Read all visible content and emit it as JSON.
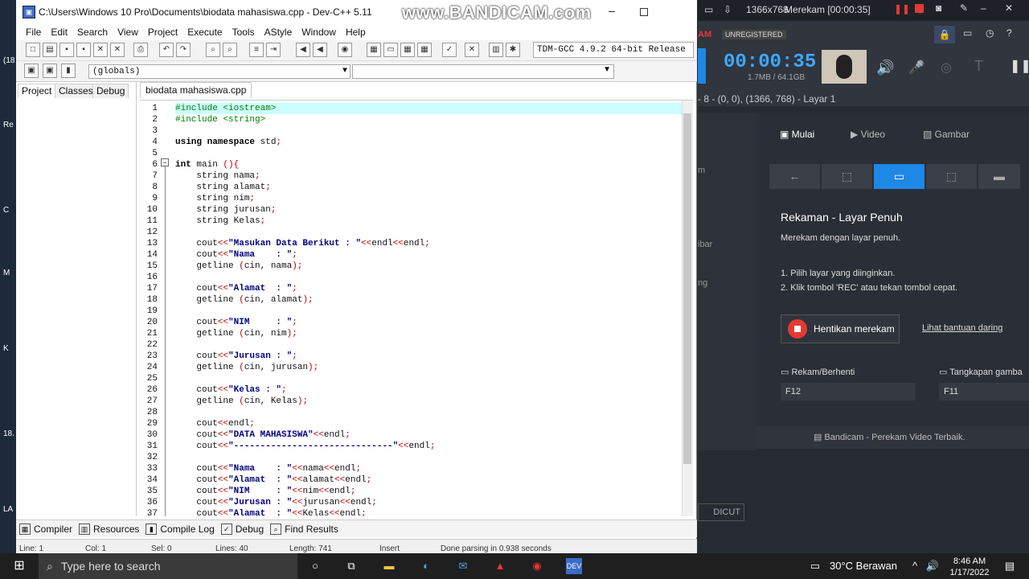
{
  "devcpp": {
    "title": "C:\\Users\\Windows 10 Pro\\Documents\\biodata mahasiswa.cpp - Dev-C++ 5.11",
    "menu": [
      "File",
      "Edit",
      "Search",
      "View",
      "Project",
      "Execute",
      "Tools",
      "AStyle",
      "Window",
      "Help"
    ],
    "compiler": "TDM-GCC 4.9.2 64-bit Release",
    "scope": "(globals)",
    "panel_tabs": [
      "Project",
      "Classes",
      "Debug"
    ],
    "file_tab": "biodata mahasiswa.cpp",
    "bottom_tabs": [
      "Compiler",
      "Resources",
      "Compile Log",
      "Debug",
      "Find Results"
    ],
    "status": [
      "Line: 1",
      "Col: 1",
      "Sel: 0",
      "Lines: 40",
      "Length: 741",
      "Insert",
      "Done parsing in 0.938 seconds"
    ],
    "code_lines": [
      {
        "n": "1",
        "t": [
          {
            "c": "pp",
            "s": "#include <iostream>"
          }
        ]
      },
      {
        "n": "2",
        "t": [
          {
            "c": "pp",
            "s": "#include <string>"
          }
        ]
      },
      {
        "n": "3",
        "t": []
      },
      {
        "n": "4",
        "t": [
          {
            "c": "kw",
            "s": "using namespace"
          },
          {
            "c": "",
            "s": " std"
          },
          {
            "c": "sym",
            "s": ";"
          }
        ]
      },
      {
        "n": "5",
        "t": []
      },
      {
        "n": "6",
        "t": [
          {
            "c": "kw",
            "s": "int"
          },
          {
            "c": "",
            "s": " main "
          },
          {
            "c": "sym",
            "s": "(){"
          }
        ]
      },
      {
        "n": "7",
        "t": [
          {
            "c": "",
            "s": "    string nama"
          },
          {
            "c": "sym",
            "s": ";"
          }
        ]
      },
      {
        "n": "8",
        "t": [
          {
            "c": "",
            "s": "    string alamat"
          },
          {
            "c": "sym",
            "s": ";"
          }
        ]
      },
      {
        "n": "9",
        "t": [
          {
            "c": "",
            "s": "    string nim"
          },
          {
            "c": "sym",
            "s": ";"
          }
        ]
      },
      {
        "n": "10",
        "t": [
          {
            "c": "",
            "s": "    string jurusan"
          },
          {
            "c": "sym",
            "s": ";"
          }
        ]
      },
      {
        "n": "11",
        "t": [
          {
            "c": "",
            "s": "    string Kelas"
          },
          {
            "c": "sym",
            "s": ";"
          }
        ]
      },
      {
        "n": "12",
        "t": []
      },
      {
        "n": "13",
        "t": [
          {
            "c": "",
            "s": "    cout"
          },
          {
            "c": "sym",
            "s": "<<"
          },
          {
            "c": "str",
            "s": "\"Masukan Data Berikut : \""
          },
          {
            "c": "sym",
            "s": "<<"
          },
          {
            "c": "",
            "s": "endl"
          },
          {
            "c": "sym",
            "s": "<<"
          },
          {
            "c": "",
            "s": "endl"
          },
          {
            "c": "sym",
            "s": ";"
          }
        ]
      },
      {
        "n": "14",
        "t": [
          {
            "c": "",
            "s": "    cout"
          },
          {
            "c": "sym",
            "s": "<<"
          },
          {
            "c": "str",
            "s": "\"Nama    : \""
          },
          {
            "c": "sym",
            "s": ";"
          }
        ]
      },
      {
        "n": "15",
        "t": [
          {
            "c": "",
            "s": "    getline "
          },
          {
            "c": "sym",
            "s": "("
          },
          {
            "c": "",
            "s": "cin, nama"
          },
          {
            "c": "sym",
            "s": ");"
          }
        ]
      },
      {
        "n": "16",
        "t": []
      },
      {
        "n": "17",
        "t": [
          {
            "c": "",
            "s": "    cout"
          },
          {
            "c": "sym",
            "s": "<<"
          },
          {
            "c": "str",
            "s": "\"Alamat  : \""
          },
          {
            "c": "sym",
            "s": ";"
          }
        ]
      },
      {
        "n": "18",
        "t": [
          {
            "c": "",
            "s": "    getline "
          },
          {
            "c": "sym",
            "s": "("
          },
          {
            "c": "",
            "s": "cin, alamat"
          },
          {
            "c": "sym",
            "s": ");"
          }
        ]
      },
      {
        "n": "19",
        "t": []
      },
      {
        "n": "20",
        "t": [
          {
            "c": "",
            "s": "    cout"
          },
          {
            "c": "sym",
            "s": "<<"
          },
          {
            "c": "str",
            "s": "\"NIM     : \""
          },
          {
            "c": "sym",
            "s": ";"
          }
        ]
      },
      {
        "n": "21",
        "t": [
          {
            "c": "",
            "s": "    getline "
          },
          {
            "c": "sym",
            "s": "("
          },
          {
            "c": "",
            "s": "cin, nim"
          },
          {
            "c": "sym",
            "s": ");"
          }
        ]
      },
      {
        "n": "22",
        "t": []
      },
      {
        "n": "23",
        "t": [
          {
            "c": "",
            "s": "    cout"
          },
          {
            "c": "sym",
            "s": "<<"
          },
          {
            "c": "str",
            "s": "\"Jurusan : \""
          },
          {
            "c": "sym",
            "s": ";"
          }
        ]
      },
      {
        "n": "24",
        "t": [
          {
            "c": "",
            "s": "    getline "
          },
          {
            "c": "sym",
            "s": "("
          },
          {
            "c": "",
            "s": "cin, jurusan"
          },
          {
            "c": "sym",
            "s": ");"
          }
        ]
      },
      {
        "n": "25",
        "t": []
      },
      {
        "n": "26",
        "t": [
          {
            "c": "",
            "s": "    cout"
          },
          {
            "c": "sym",
            "s": "<<"
          },
          {
            "c": "str",
            "s": "\"Kelas : \""
          },
          {
            "c": "sym",
            "s": ";"
          }
        ]
      },
      {
        "n": "27",
        "t": [
          {
            "c": "",
            "s": "    getline "
          },
          {
            "c": "sym",
            "s": "("
          },
          {
            "c": "",
            "s": "cin, Kelas"
          },
          {
            "c": "sym",
            "s": ");"
          }
        ]
      },
      {
        "n": "28",
        "t": []
      },
      {
        "n": "29",
        "t": [
          {
            "c": "",
            "s": "    cout"
          },
          {
            "c": "sym",
            "s": "<<"
          },
          {
            "c": "",
            "s": "endl"
          },
          {
            "c": "sym",
            "s": ";"
          }
        ]
      },
      {
        "n": "30",
        "t": [
          {
            "c": "",
            "s": "    cout"
          },
          {
            "c": "sym",
            "s": "<<"
          },
          {
            "c": "str",
            "s": "\"DATA MAHASISWA\""
          },
          {
            "c": "sym",
            "s": "<<"
          },
          {
            "c": "",
            "s": "endl"
          },
          {
            "c": "sym",
            "s": ";"
          }
        ]
      },
      {
        "n": "31",
        "t": [
          {
            "c": "",
            "s": "    cout"
          },
          {
            "c": "sym",
            "s": "<<"
          },
          {
            "c": "str",
            "s": "\"------------------------------\""
          },
          {
            "c": "sym",
            "s": "<<"
          },
          {
            "c": "",
            "s": "endl"
          },
          {
            "c": "sym",
            "s": ";"
          }
        ]
      },
      {
        "n": "32",
        "t": []
      },
      {
        "n": "33",
        "t": [
          {
            "c": "",
            "s": "    cout"
          },
          {
            "c": "sym",
            "s": "<<"
          },
          {
            "c": "str",
            "s": "\"Nama    : \""
          },
          {
            "c": "sym",
            "s": "<<"
          },
          {
            "c": "",
            "s": "nama"
          },
          {
            "c": "sym",
            "s": "<<"
          },
          {
            "c": "",
            "s": "endl"
          },
          {
            "c": "sym",
            "s": ";"
          }
        ]
      },
      {
        "n": "34",
        "t": [
          {
            "c": "",
            "s": "    cout"
          },
          {
            "c": "sym",
            "s": "<<"
          },
          {
            "c": "str",
            "s": "\"Alamat  : \""
          },
          {
            "c": "sym",
            "s": "<<"
          },
          {
            "c": "",
            "s": "alamat"
          },
          {
            "c": "sym",
            "s": "<<"
          },
          {
            "c": "",
            "s": "endl"
          },
          {
            "c": "sym",
            "s": ";"
          }
        ]
      },
      {
        "n": "35",
        "t": [
          {
            "c": "",
            "s": "    cout"
          },
          {
            "c": "sym",
            "s": "<<"
          },
          {
            "c": "str",
            "s": "\"NIM     : \""
          },
          {
            "c": "sym",
            "s": "<<"
          },
          {
            "c": "",
            "s": "nim"
          },
          {
            "c": "sym",
            "s": "<<"
          },
          {
            "c": "",
            "s": "endl"
          },
          {
            "c": "sym",
            "s": ";"
          }
        ]
      },
      {
        "n": "36",
        "t": [
          {
            "c": "",
            "s": "    cout"
          },
          {
            "c": "sym",
            "s": "<<"
          },
          {
            "c": "str",
            "s": "\"Jurusan : \""
          },
          {
            "c": "sym",
            "s": "<<"
          },
          {
            "c": "",
            "s": "jurusan"
          },
          {
            "c": "sym",
            "s": "<<"
          },
          {
            "c": "",
            "s": "endl"
          },
          {
            "c": "sym",
            "s": ";"
          }
        ]
      },
      {
        "n": "37",
        "t": [
          {
            "c": "",
            "s": "    cout"
          },
          {
            "c": "sym",
            "s": "<<"
          },
          {
            "c": "str",
            "s": "\"Alamat  : \""
          },
          {
            "c": "sym",
            "s": "<<"
          },
          {
            "c": "",
            "s": "Kelas"
          },
          {
            "c": "sym",
            "s": "<<"
          },
          {
            "c": "",
            "s": "endl"
          },
          {
            "c": "sym",
            "s": ";"
          }
        ]
      }
    ]
  },
  "watermark": "www.BANDICAM.com",
  "bandicam": {
    "top_res": "1366x768",
    "top_rec": "Merekam [00:00:35]",
    "unregistered": "UNREGISTERED",
    "rec_time": "00:00:35",
    "rec_size": "1.7MB / 64.1GB",
    "res_line": "- 8 - (0, 0), (1366, 768) - Layar 1",
    "tabs": [
      "Mulai",
      "Video",
      "Gambar"
    ],
    "title": "Rekaman - Layar Penuh",
    "desc": "Merekam dengan layar penuh.",
    "step1": "1. Pilih layar yang diinginkan.",
    "step2": "2. Klik tombol 'REC' atau tekan tombol cepat.",
    "stop": "Hentikan merekam",
    "help": "Lihat bantuan daring",
    "hk1_label": "Rekam/Berhenti",
    "hk1": "F12",
    "hk2_label": "Tangkapan gamba",
    "hk2": "F11",
    "shortcut": "DICUT",
    "footer": "Bandicam - Perekam Video Terbaik.",
    "side_labels": [
      "m",
      "ibar",
      "ng"
    ]
  },
  "desktop_labels": [
    "(18",
    "Re",
    "C",
    "M",
    "K",
    "18.",
    "LA"
  ],
  "taskbar": {
    "search": "Type here to search",
    "weather": "30°C  Berawan",
    "time": "8:46 AM",
    "date": "1/17/2022"
  }
}
